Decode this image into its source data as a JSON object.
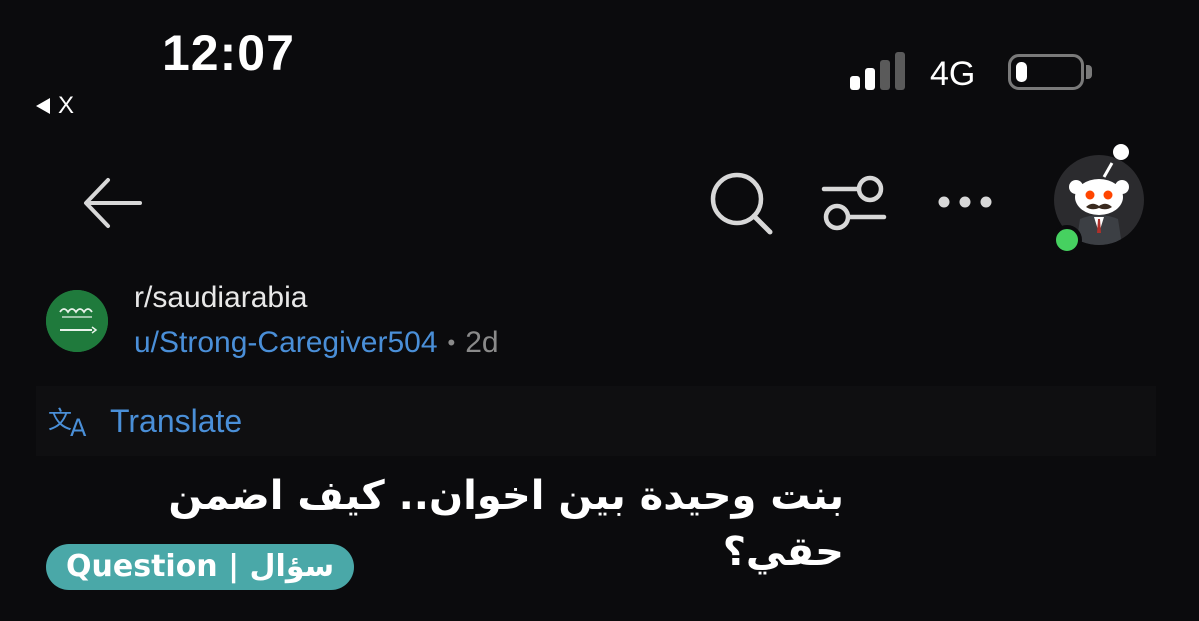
{
  "status_bar": {
    "time": "12:07",
    "back_app_label": "X",
    "network": "4G",
    "signal_bars_active": 2,
    "signal_bars_total": 4,
    "battery_level": 0.18
  },
  "toolbar": {
    "back_icon": "arrow-left-icon",
    "search_icon": "search-icon",
    "filter_icon": "sliders-icon",
    "more_icon": "more-horizontal-icon",
    "avatar_icon": "snoo-avatar-icon"
  },
  "post": {
    "subreddit": "r/saudiarabia",
    "username": "u/Strong-Caregiver504",
    "separator": "•",
    "age": "2d",
    "translate_icon": "translate-icon",
    "translate_label": "Translate",
    "title": "بنت وحيدة بين اخوان.. كيف اضمن حقي؟",
    "flair": "Question | سؤال"
  },
  "colors": {
    "background": "#0b0b0d",
    "link_blue": "#4a8fd8",
    "flair_teal": "#4aa8a8",
    "online_green": "#46d160",
    "subreddit_icon_green": "#1f7a3c"
  }
}
